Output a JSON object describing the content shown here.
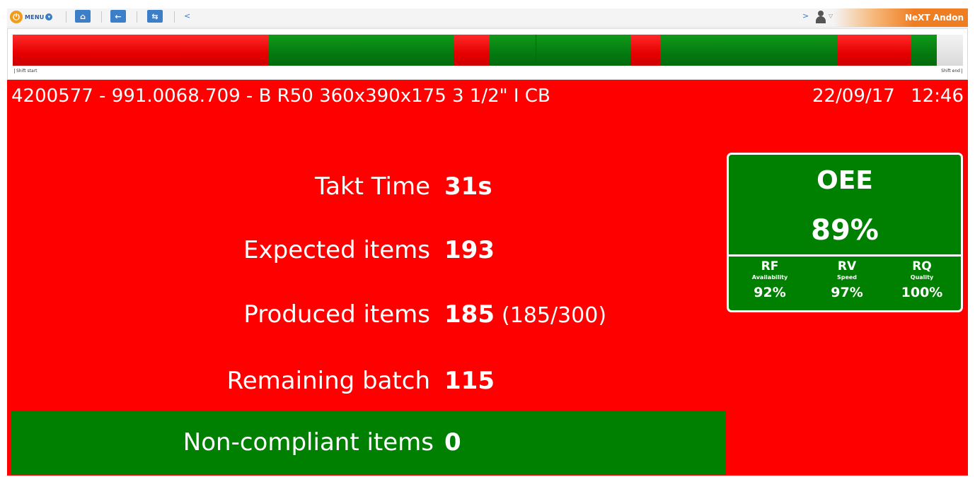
{
  "toolbar": {
    "menu_label": "MENU",
    "prev_chevron": "<",
    "next_chevron": ">",
    "brand": "NeXT Andon"
  },
  "timeline": {
    "start_label": "Shift start",
    "end_label": "Shift end",
    "segment_states": [
      "stop",
      "run",
      "stop",
      "run",
      "run",
      "stop",
      "run",
      "stop",
      "run",
      "remaining"
    ],
    "colors": {
      "stop": "#e00000",
      "run": "#057a10",
      "remaining": "#dddddd"
    }
  },
  "header": {
    "title": "4200577 - 991.0068.709 - B R50 360x390x175 3 1/2\" I CB",
    "date": "22/09/17",
    "time": "12:46"
  },
  "metrics": {
    "takt_label": "Takt Time",
    "takt_value": "31s",
    "expected_label": "Expected items",
    "expected_value": "193",
    "produced_label": "Produced items",
    "produced_value": "185",
    "produced_extra": "(185/300)",
    "remaining_label": "Remaining batch",
    "remaining_value": "115",
    "noncompliant_label": "Non-compliant items",
    "noncompliant_value": "0"
  },
  "oee": {
    "title": "OEE",
    "value": "89%",
    "rf": {
      "key": "RF",
      "name": "Availability",
      "value": "92%"
    },
    "rv": {
      "key": "RV",
      "name": "Speed",
      "value": "97%"
    },
    "rq": {
      "key": "RQ",
      "name": "Quality",
      "value": "100%"
    }
  },
  "colors": {
    "alert_red": "#ff0000",
    "ok_green": "#008000",
    "brand_orange": "#ef7d22",
    "toolbar_blue": "#3d7ec9"
  },
  "icons": [
    "power-icon",
    "menu-dropdown-icon",
    "home-icon",
    "back-arrow-icon",
    "refresh-icon",
    "user-icon"
  ]
}
